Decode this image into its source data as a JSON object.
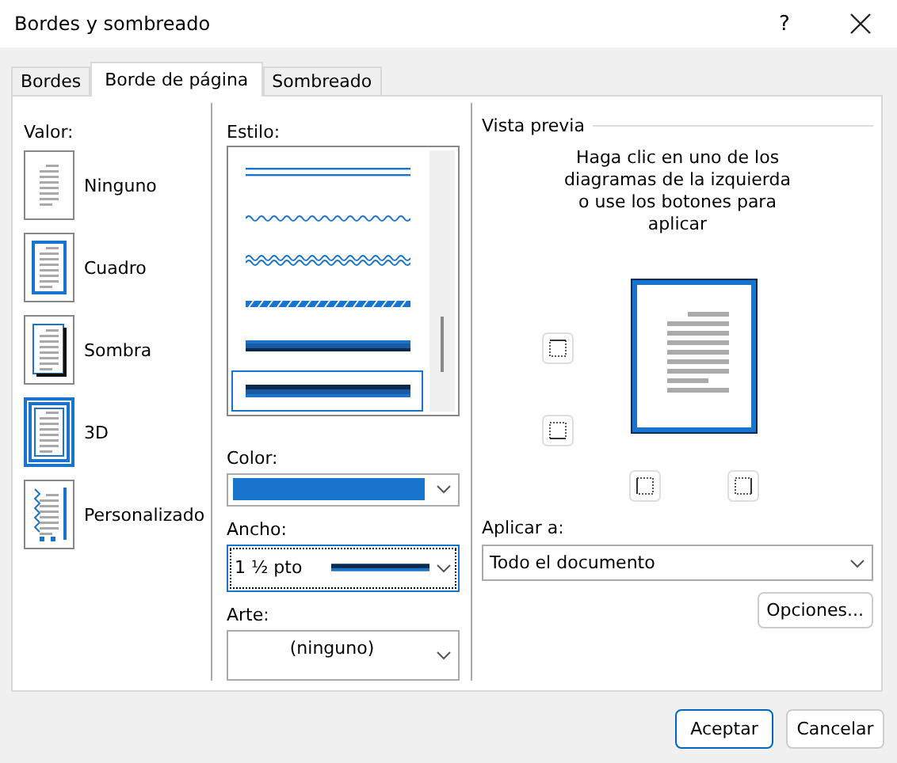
{
  "window": {
    "title": "Bordes y sombreado",
    "help": "?"
  },
  "tabs": [
    {
      "label": "Bordes",
      "selected": false
    },
    {
      "label": "Borde de página",
      "selected": true
    },
    {
      "label": "Sombreado",
      "selected": false
    }
  ],
  "valor": {
    "label": "Valor:",
    "options": [
      {
        "label": "Ninguno",
        "kind": "none",
        "selected": false
      },
      {
        "label": "Cuadro",
        "kind": "box",
        "selected": false
      },
      {
        "label": "Sombra",
        "kind": "shadow",
        "selected": false
      },
      {
        "label": "3D",
        "kind": "threed",
        "selected": true
      },
      {
        "label": "Personalizado",
        "kind": "custom",
        "selected": false
      }
    ]
  },
  "estilo": {
    "label": "Estilo:",
    "styles": [
      {
        "kind": "double",
        "selected": false
      },
      {
        "kind": "wave",
        "selected": false
      },
      {
        "kind": "double-wave",
        "selected": false
      },
      {
        "kind": "striped",
        "selected": false
      },
      {
        "kind": "thick-thin",
        "selected": false
      },
      {
        "kind": "thin-thick",
        "selected": true
      }
    ]
  },
  "color": {
    "label": "Color:",
    "color": "#1874cd"
  },
  "ancho": {
    "label": "Ancho:",
    "value": "1 ½ pto"
  },
  "arte": {
    "label": "Arte:",
    "value": "(ninguno)"
  },
  "preview": {
    "title": "Vista previa",
    "hint": "Haga clic en uno de los diagramas de la izquierda o use los botones para aplicar"
  },
  "aplicar": {
    "label": "Aplicar a:",
    "value": "Todo el documento"
  },
  "options_button": "Opciones...",
  "buttons": [
    "Aceptar",
    "Cancelar"
  ]
}
